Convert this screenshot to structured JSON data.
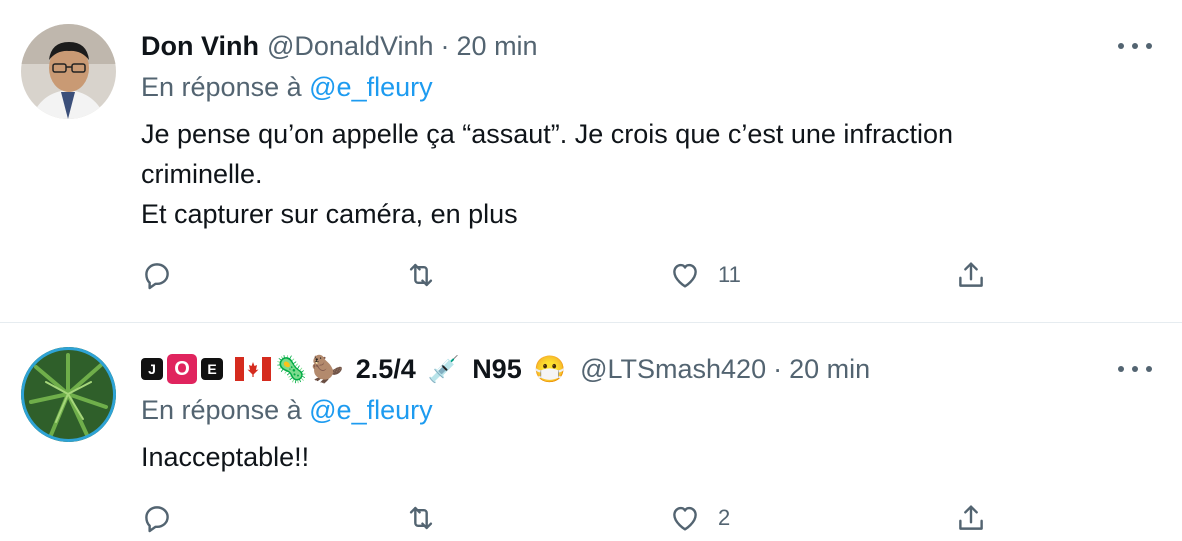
{
  "tweets": [
    {
      "name": "Don Vinh",
      "handle": "@DonaldVinh",
      "separator": "·",
      "time": "20 min",
      "reply_prefix": "En réponse à",
      "reply_mention": "@e_fleury",
      "lines": [
        "Je pense qu’on appelle ça “assaut”. Je crois que c’est une infraction",
        "criminelle.",
        "Et capturer sur caméra, en plus"
      ],
      "actions": {
        "reply_count": "",
        "retweet_count": "",
        "like_count": "11"
      }
    },
    {
      "name_badges": {
        "j": "J",
        "o": "O",
        "e": "E",
        "virus": "🦠",
        "beaver": "🦫",
        "syringe": "💉",
        "mask": "😷"
      },
      "name_text_1": "2.5/4",
      "name_text_2": "N95",
      "handle": "@LTSmash420",
      "separator": "·",
      "time": "20 min",
      "reply_prefix": "En réponse à",
      "reply_mention": "@e_fleury",
      "lines": [
        "Inacceptable!!"
      ],
      "actions": {
        "reply_count": "",
        "retweet_count": "",
        "like_count": "2"
      }
    }
  ],
  "colors": {
    "link": "#1d9bf0",
    "secondary": "#536471",
    "text": "#0f1419",
    "divider": "#e6ecf0"
  }
}
